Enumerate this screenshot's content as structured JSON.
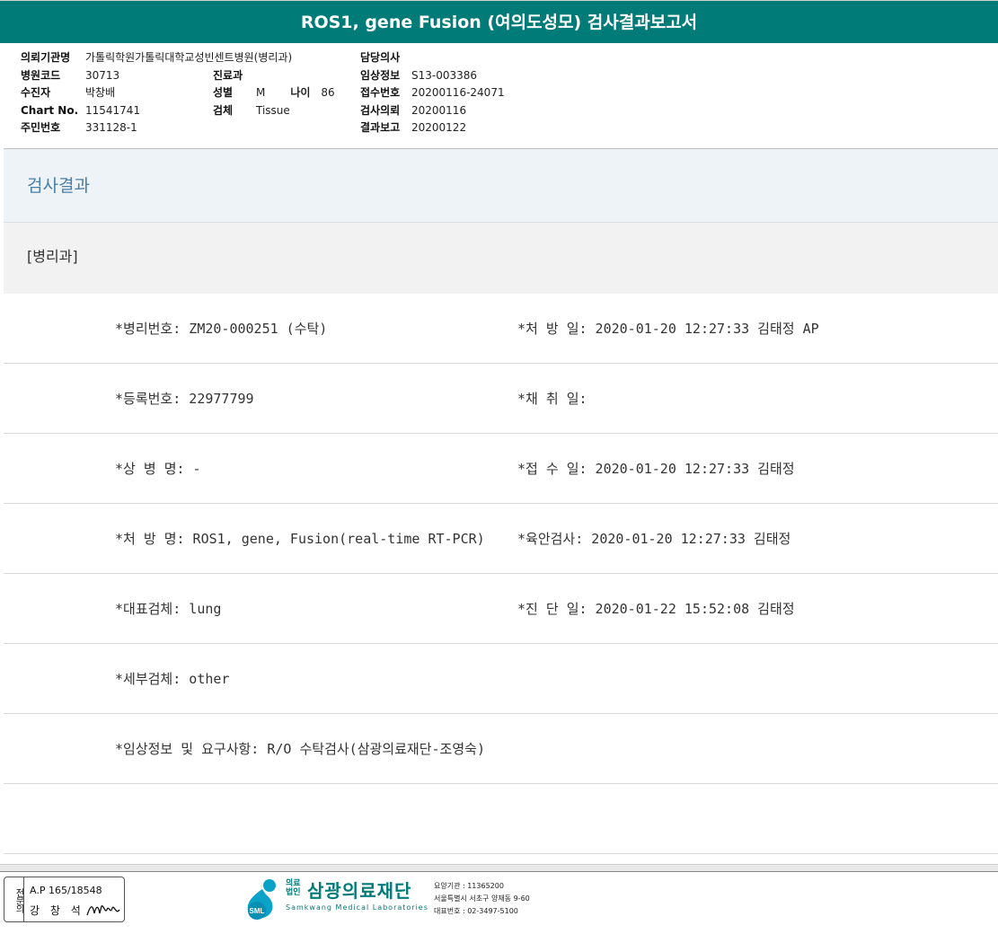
{
  "report": {
    "title": "ROS1, gene Fusion (여의도성모) 검사결과보고서"
  },
  "patient_info": {
    "col1": [
      {
        "label": "의뢰기관명",
        "value": "가톨릭학원가톨릭대학교성빈센트병원(병리과)"
      },
      {
        "label": "병원코드",
        "value": "30713"
      },
      {
        "label": "수진자",
        "value": "박창배"
      },
      {
        "label": "Chart No.",
        "value": "11541741"
      },
      {
        "label": "주민번호",
        "value": "331128-1"
      }
    ],
    "col2": {
      "dept_label": "진료과",
      "dept_value": "",
      "sex_label": "성별",
      "sex_value": "M",
      "age_label": "나이",
      "age_value": "86",
      "specimen_label": "검체",
      "specimen_value": "Tissue"
    },
    "col3": [
      {
        "label": "담당의사",
        "value": ""
      },
      {
        "label": "임상정보",
        "value": "S13-003386"
      },
      {
        "label": "접수번호",
        "value": "20200116-24071"
      },
      {
        "label": "검사의뢰",
        "value": "20200116"
      },
      {
        "label": "결과보고",
        "value": "20200122"
      }
    ]
  },
  "results": {
    "section_title": "검사결과",
    "sub_title": "[병리과]",
    "rows": [
      {
        "left": "*병리번호: ZM20-000251 (수탁)",
        "right": "*처 방 일: 2020-01-20 12:27:33  김태정 AP"
      },
      {
        "left": "*등록번호: 22977799",
        "right": "*채 취 일:"
      },
      {
        "left": "*상 병 명: -",
        "right": "*접 수 일: 2020-01-20 12:27:33  김태정"
      },
      {
        "left": "*처 방 명: ROS1, gene, Fusion(real-time RT-PCR)",
        "right": "*육안검사: 2020-01-20 12:27:33  김태정"
      },
      {
        "left": "*대표검체: lung",
        "right": "*진 단 일: 2020-01-22 15:52:08  김태정"
      },
      {
        "left": "*세부검체: other",
        "right": ""
      },
      {
        "left": "*임상정보 및 요구사항: R/O 수탁검사(삼광의료재단-조영숙)",
        "right": ""
      }
    ]
  },
  "footer": {
    "stamp_vertical": "전문의",
    "stamp_ap": "A.P 165/18548",
    "stamp_name": "강 창 석",
    "logo_corp_line1": "의료",
    "logo_corp_line2": "법인",
    "logo_name": "삼광의료재단",
    "logo_english": "Samkwang Medical Laboratories",
    "logo_badge": "SML",
    "care_org_no": "요양기관 : 11365200",
    "address": "서울특별시 서초구 양재동 9-60",
    "phone": "대표번호 : 02-3497-5100",
    "brand_color": "#007b78"
  }
}
